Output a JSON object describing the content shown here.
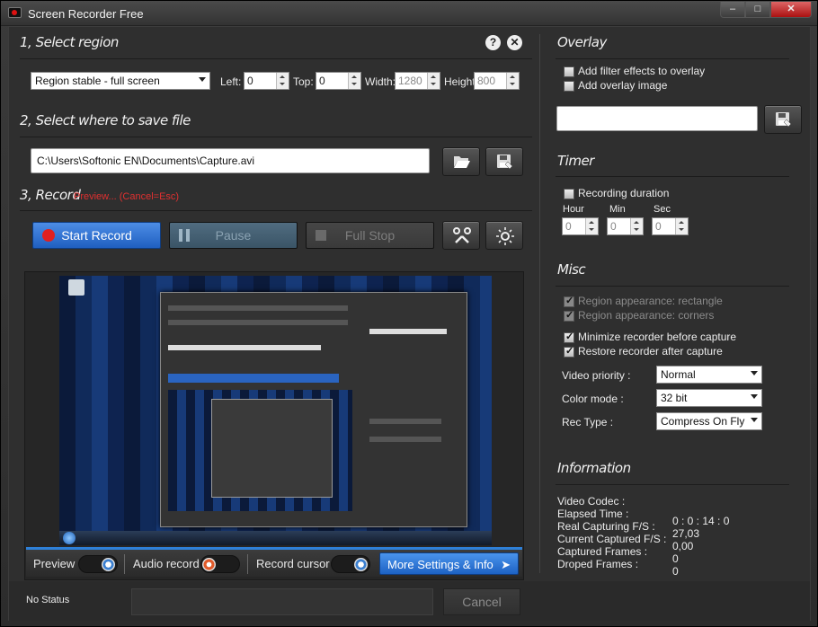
{
  "window": {
    "title": "Screen Recorder Free",
    "minimize": "–",
    "maximize": "□",
    "close": "✕"
  },
  "region": {
    "title": "1, Select region",
    "help_icon": "?",
    "close_icon": "✕",
    "mode": "Region stable - full screen",
    "left_label": "Left:",
    "left": "0",
    "top_label": "Top:",
    "top": "0",
    "width_label": "Width:",
    "width": "1280",
    "height_label": "Height",
    "height": "800"
  },
  "save": {
    "title": "2, Select where to save file",
    "path": "C:\\Users\\Softonic EN\\Documents\\Capture.avi"
  },
  "record": {
    "title": "3, Record",
    "preview_note": "Preview... (Cancel=Esc)",
    "start_label": "Start Record",
    "pause_label": "Pause",
    "stop_label": "Full Stop"
  },
  "toggles": {
    "preview_label": "Preview",
    "audio_label": "Audio record",
    "cursor_label": "Record cursor",
    "more_label": "More Settings & Info"
  },
  "status": {
    "text": "No Status",
    "cancel_label": "Cancel"
  },
  "overlay": {
    "title": "Overlay",
    "filter_effects": "Add filter effects to overlay",
    "overlay_image": "Add overlay image"
  },
  "timer": {
    "title": "Timer",
    "duration_label": "Recording duration",
    "hour_label": "Hour",
    "hour": "0",
    "min_label": "Min",
    "min": "0",
    "sec_label": "Sec",
    "sec": "0"
  },
  "misc": {
    "title": "Misc",
    "region_rect": "Region appearance: rectangle",
    "region_corners": "Region appearance: corners",
    "minimize": "Minimize recorder before capture",
    "restore": "Restore recorder after capture",
    "priority_label": "Video priority :",
    "priority": "Normal",
    "color_label": "Color mode :",
    "color": "32 bit",
    "rectype_label": "Rec Type :",
    "rectype": "Compress On Fly"
  },
  "information": {
    "title": "Information",
    "labels": [
      "Video Codec :",
      "Elapsed Time :",
      "Real Capturing F/S :",
      "Current Captured F/S :",
      "Captured Frames :",
      "Droped Frames :"
    ],
    "values": [
      "0 : 0 : 14 : 0",
      "27,03",
      "0,00",
      "0",
      "0"
    ]
  },
  "colors": {
    "accent": "#2e80d8",
    "record_red": "#e02020",
    "preview_note": "#e03030"
  }
}
